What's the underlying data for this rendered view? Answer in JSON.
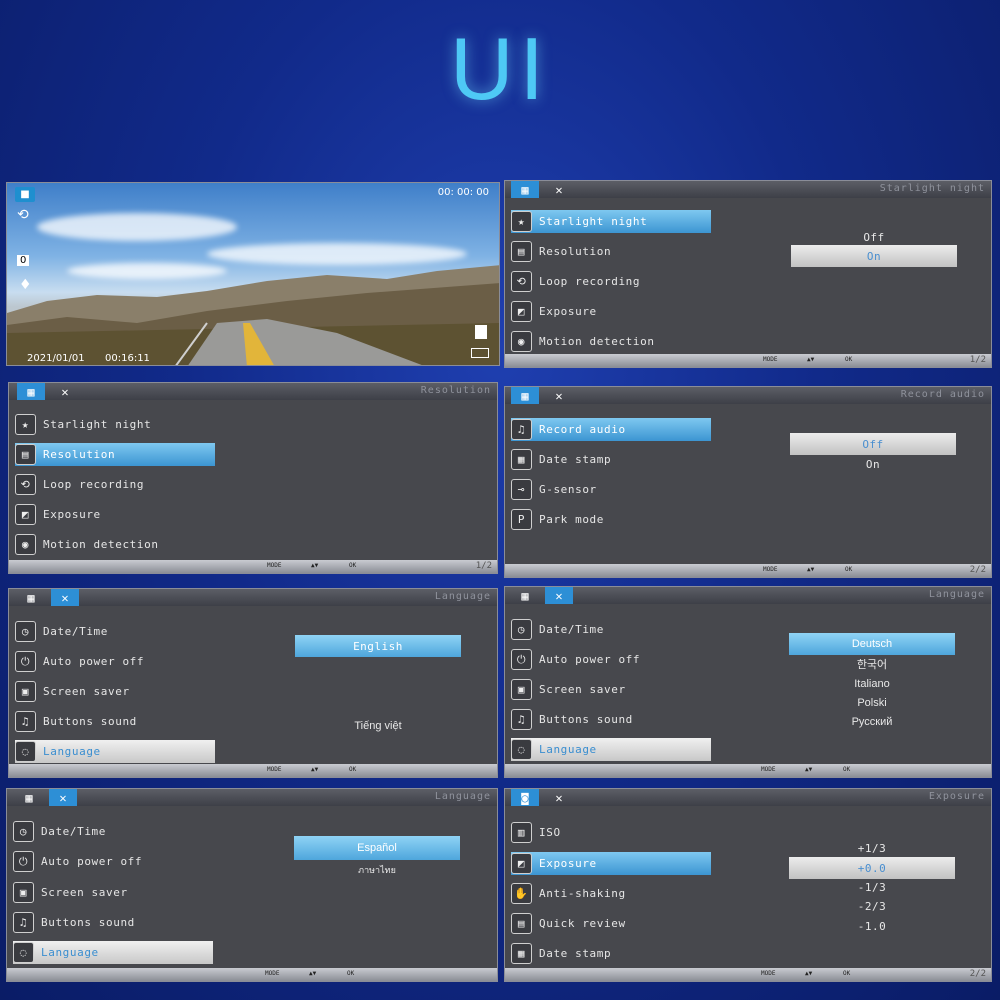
{
  "heading": "UI",
  "camera": {
    "timer": "00: 00: 00",
    "date": "2021/01/01",
    "time": "00:16:11",
    "ev": "0"
  },
  "panels": [
    {
      "title": "Starlight night",
      "page": "1/2",
      "items": [
        "Starlight night",
        "Resolution",
        "Loop recording",
        "Exposure",
        "Motion detection"
      ],
      "options": [
        "Off",
        "On"
      ]
    },
    {
      "title": "Resolution",
      "page": "1/2",
      "items": [
        "Starlight night",
        "Resolution",
        "Loop recording",
        "Exposure",
        "Motion detection"
      ]
    },
    {
      "title": "Record audio",
      "page": "2/2",
      "items": [
        "Record audio",
        "Date stamp",
        "G-sensor",
        "Park mode"
      ],
      "options": [
        "Off",
        "On"
      ]
    },
    {
      "title": "Language",
      "items": [
        "Date/Time",
        "Auto power off",
        "Screen saver",
        "Buttons sound",
        "Language"
      ],
      "options": [
        "English",
        "Tiếng việt"
      ]
    },
    {
      "title": "Language",
      "items": [
        "Date/Time",
        "Auto power off",
        "Screen saver",
        "Buttons sound",
        "Language"
      ],
      "options": [
        "Deutsch",
        "한국어",
        "Italiano",
        "Polski",
        "Русский"
      ]
    },
    {
      "title": "Language",
      "items": [
        "Date/Time",
        "Auto power off",
        "Screen saver",
        "Buttons sound",
        "Language"
      ],
      "options": [
        "Español",
        "ภาษาไทย"
      ]
    },
    {
      "title": "Exposure",
      "page": "2/2",
      "items": [
        "ISO",
        "Exposure",
        "Anti-shaking",
        "Quick review",
        "Date stamp"
      ],
      "options": [
        "+1/3",
        "+0.0",
        "-1/3",
        "-2/3",
        "-1.0"
      ]
    }
  ],
  "footer": {
    "mode_label": "MODE",
    "ok_label": "OK"
  },
  "colors": {
    "accent": "#2d8fd6",
    "heading": "#4ec9f5",
    "panel_bg": "#47484d"
  }
}
